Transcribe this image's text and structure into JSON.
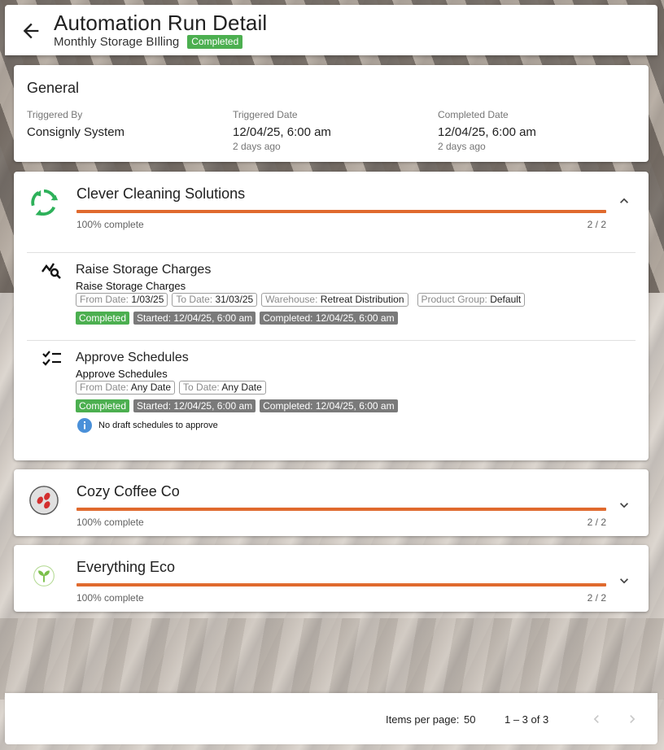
{
  "header": {
    "title": "Automation Run Detail",
    "subtitle": "Monthly Storage BIlling",
    "status": "Completed"
  },
  "general": {
    "title": "General",
    "triggered_by_label": "Triggered By",
    "triggered_by_value": "Consignly System",
    "triggered_date_label": "Triggered Date",
    "triggered_date_value": "12/04/25, 6:00 am",
    "triggered_date_relative": "2 days ago",
    "completed_date_label": "Completed Date",
    "completed_date_value": "12/04/25, 6:00 am",
    "completed_date_relative": "2 days ago"
  },
  "customers": [
    {
      "name": "Clever Cleaning Solutions",
      "icon": "recycle-icon",
      "progress_text": "100% complete",
      "progress_fraction": 1.0,
      "count": "2 / 2",
      "expanded": true,
      "tasks": [
        {
          "icon": "chart-search-icon",
          "title": "Raise Storage Charges",
          "subtitle": "Raise Storage Charges",
          "params": [
            {
              "key": "From Date:",
              "value": "1/03/25"
            },
            {
              "key": "To Date:",
              "value": "31/03/25"
            },
            {
              "key": "Warehouse:",
              "value": "Retreat Distribution"
            },
            {
              "key": "Product Group:",
              "value": "Default"
            }
          ],
          "status": "Completed",
          "started": "Started: 12/04/25, 6:00 am",
          "completed": "Completed: 12/04/25, 6:00 am"
        },
        {
          "icon": "checklist-icon",
          "title": "Approve Schedules",
          "subtitle": "Approve Schedules",
          "params": [
            {
              "key": "From Date:",
              "value": "Any Date"
            },
            {
              "key": "To Date:",
              "value": "Any Date"
            }
          ],
          "status": "Completed",
          "started": "Started: 12/04/25, 6:00 am",
          "completed": "Completed: 12/04/25, 6:00 am",
          "info": "No draft schedules to approve"
        }
      ]
    },
    {
      "name": "Cozy Coffee Co",
      "icon": "coffee-beans-icon",
      "progress_text": "100% complete",
      "progress_fraction": 1.0,
      "count": "2 / 2",
      "expanded": false
    },
    {
      "name": "Everything Eco",
      "icon": "sprout-icon",
      "progress_text": "100% complete",
      "progress_fraction": 1.0,
      "count": "2 / 2",
      "expanded": false
    }
  ],
  "footer": {
    "items_per_page_label": "Items per page:",
    "items_per_page_value": "50",
    "range": "1 – 3 of 3"
  },
  "colors": {
    "accent_progress": "#e06a2e",
    "status_completed": "#4caf50",
    "chip_dark": "#7a7a7a",
    "recycle_green": "#2eb15a",
    "coffee_red": "#d32f2f",
    "sprout_green": "#7cc04b",
    "info_blue": "#4a90d9"
  }
}
